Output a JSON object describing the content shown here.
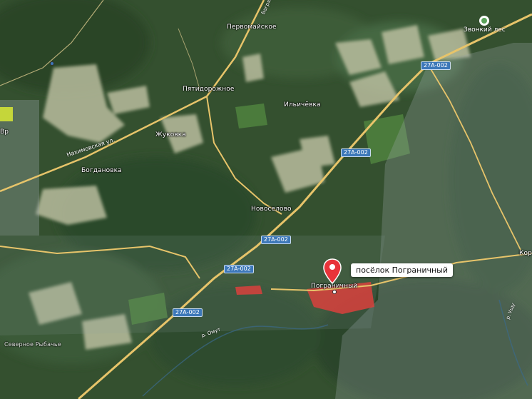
{
  "map": {
    "places": [
      {
        "id": "pervomayskoe",
        "label": "Первомайское"
      },
      {
        "id": "pyatidorozhnoe",
        "label": "Пятидорожное"
      },
      {
        "id": "ilichevka",
        "label": "Ильичёвка"
      },
      {
        "id": "zhukovka",
        "label": "Жуковка"
      },
      {
        "id": "bogdanovka",
        "label": "Богдановка"
      },
      {
        "id": "novoselovo",
        "label": "Новоселово"
      },
      {
        "id": "pogranichny",
        "label": "Пограничный"
      },
      {
        "id": "kor",
        "label": "Кор"
      },
      {
        "id": "vr",
        "label": "Вр"
      },
      {
        "id": "bottom-left",
        "label": "Северное Рыбачье"
      }
    ],
    "road_badges": [
      {
        "id": "27a002-top",
        "label": "27А-002"
      },
      {
        "id": "27a002-mid",
        "label": "27А-002"
      },
      {
        "id": "27a002-center",
        "label": "27А-002"
      },
      {
        "id": "27a002-lowleft",
        "label": "27А-002"
      },
      {
        "id": "27a002-bottom",
        "label": "27А-002"
      }
    ],
    "road_names": [
      {
        "id": "nahimova",
        "label": "Нахимовская ул."
      },
      {
        "id": "top-road",
        "label": "Багряна"
      },
      {
        "id": "omut",
        "label": "р. Омут"
      },
      {
        "id": "right-river",
        "label": "р. Ущу"
      }
    ],
    "poi": {
      "label": "Звонкий лес"
    },
    "selected": {
      "label": "посёлок Пограничный"
    },
    "colors": {
      "road": "#e7c46a",
      "badge": "#3d78b9",
      "pin": "#e8343a",
      "settlement": "#d9413d"
    }
  }
}
